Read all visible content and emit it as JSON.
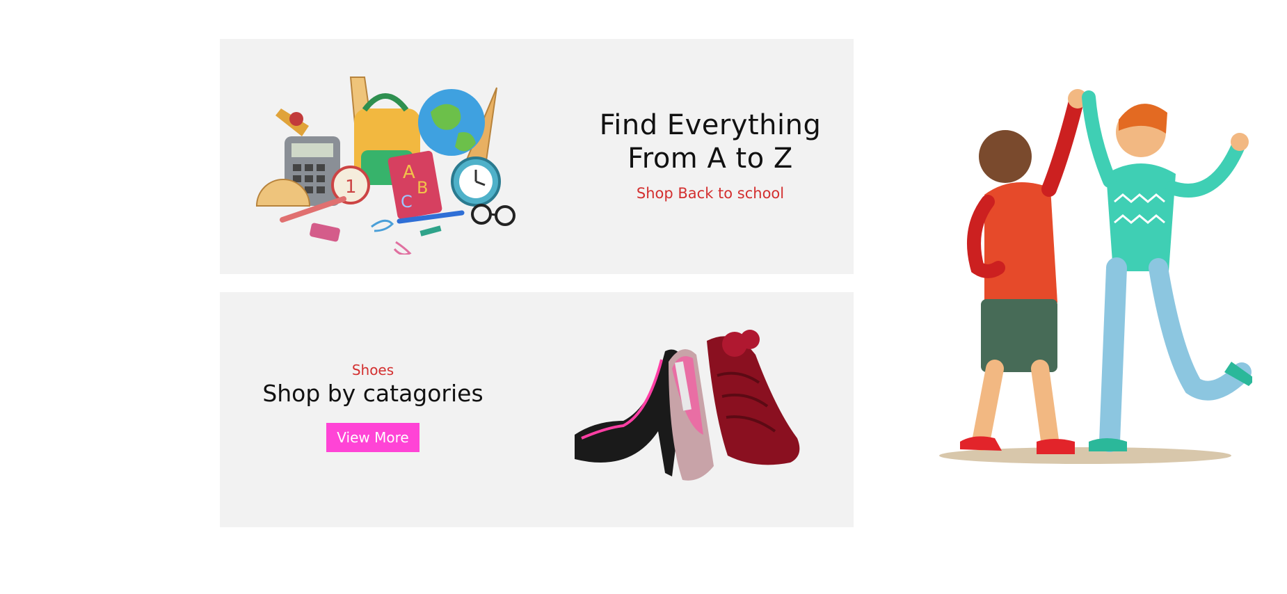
{
  "promo_school": {
    "title_line1": "Find Everything",
    "title_line2": "From A to Z",
    "link_label": "Shop Back to school",
    "image_icon": "school-supplies-icon"
  },
  "promo_shoes": {
    "kicker": "Shoes",
    "title": "Shop by catagories",
    "button_label": "View More",
    "image_icon": "high-heels-icon"
  },
  "side_illustration": {
    "image_icon": "high-five-friends-icon"
  },
  "colors": {
    "banner_bg": "#f2f2f2",
    "accent_red": "#d32f2f",
    "button_pink": "#ff44d6"
  }
}
